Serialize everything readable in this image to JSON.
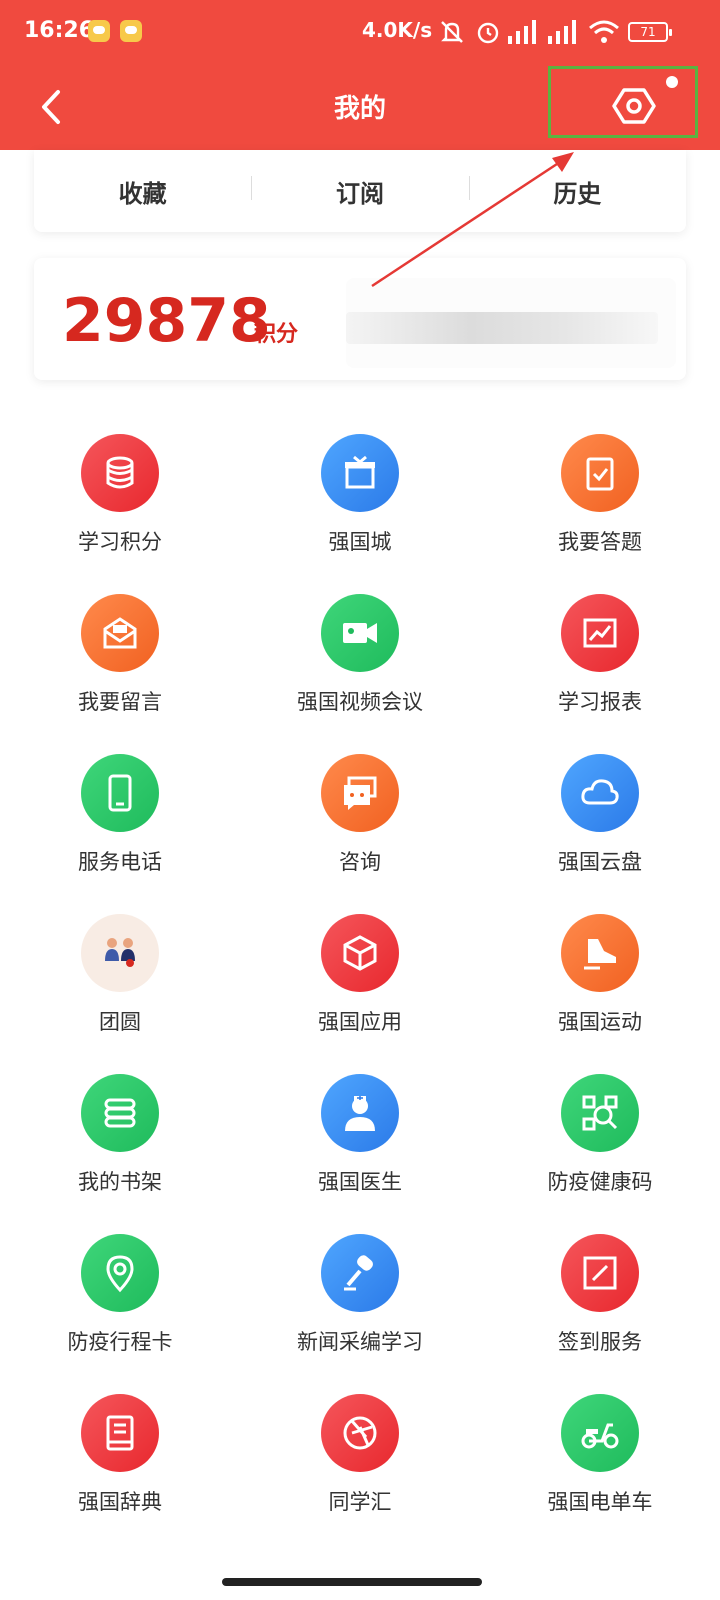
{
  "status_bar": {
    "time": "16:26",
    "net_speed": "4.0K/s",
    "battery": "71"
  },
  "header": {
    "title": "我的"
  },
  "tabs": [
    {
      "label": "收藏"
    },
    {
      "label": "订阅"
    },
    {
      "label": "历史"
    }
  ],
  "score": {
    "value": "29878",
    "unit": "积分"
  },
  "grid": [
    {
      "label": "学习积分",
      "icon": "database-icon",
      "color": "#e8282e"
    },
    {
      "label": "强国城",
      "icon": "gift-icon",
      "color": "#2b7ae8"
    },
    {
      "label": "我要答题",
      "icon": "clipboard-check-icon",
      "color": "#f16121"
    },
    {
      "label": "我要留言",
      "icon": "mail-icon",
      "color": "#f16121"
    },
    {
      "label": "强国视频会议",
      "icon": "video-camera-icon",
      "color": "#1fbb5c"
    },
    {
      "label": "学习报表",
      "icon": "chart-icon",
      "color": "#e8282e"
    },
    {
      "label": "服务电话",
      "icon": "phone-icon",
      "color": "#1fbb5c"
    },
    {
      "label": "咨询",
      "icon": "chat-icon",
      "color": "#f16121"
    },
    {
      "label": "强国云盘",
      "icon": "cloud-icon",
      "color": "#2b7ae8"
    },
    {
      "label": "团圆",
      "icon": "family-icon",
      "color": "#f8ece4"
    },
    {
      "label": "强国应用",
      "icon": "cube-icon",
      "color": "#e8282e"
    },
    {
      "label": "强国运动",
      "icon": "sneaker-icon",
      "color": "#f16121"
    },
    {
      "label": "我的书架",
      "icon": "books-icon",
      "color": "#1fbb5c"
    },
    {
      "label": "强国医生",
      "icon": "doctor-icon",
      "color": "#2b7ae8"
    },
    {
      "label": "防疫健康码",
      "icon": "qr-code-icon",
      "color": "#1fbb5c"
    },
    {
      "label": "防疫行程卡",
      "icon": "location-pin-icon",
      "color": "#1fbb5c"
    },
    {
      "label": "新闻采编学习",
      "icon": "microphone-icon",
      "color": "#2b7ae8"
    },
    {
      "label": "签到服务",
      "icon": "sign-in-icon",
      "color": "#e8282e"
    },
    {
      "label": "强国辞典",
      "icon": "dictionary-icon",
      "color": "#e8282e"
    },
    {
      "label": "同学汇",
      "icon": "aperture-icon",
      "color": "#e8282e"
    },
    {
      "label": "强国电单车",
      "icon": "scooter-icon",
      "color": "#1fbb5c"
    }
  ]
}
